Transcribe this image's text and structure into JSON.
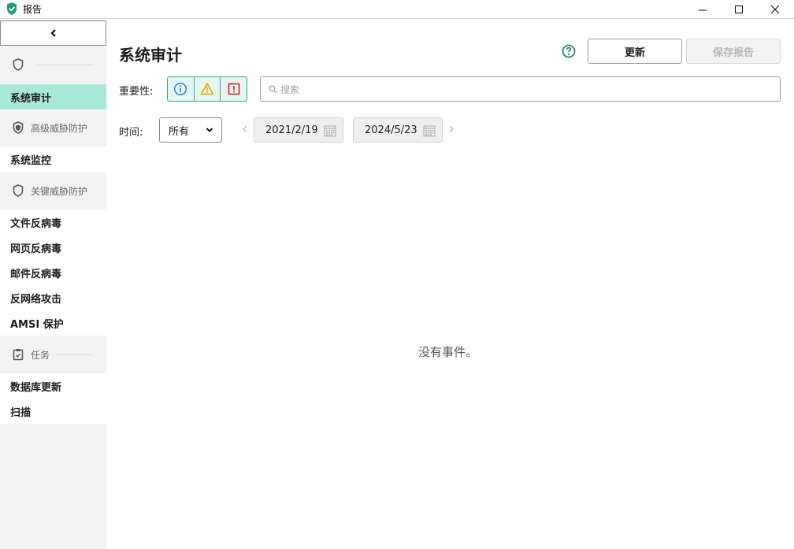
{
  "window": {
    "title": "报告"
  },
  "sidebar": {
    "sections": [
      {
        "label": "",
        "icon": "shield-icon"
      },
      {
        "label": "高级威胁防护",
        "icon": "shield-icon"
      },
      {
        "label": "关键威胁防护",
        "icon": "shield-icon"
      },
      {
        "label": "任务",
        "icon": "clipboard-check-icon"
      }
    ],
    "items": [
      {
        "label": "系统审计",
        "active": true
      },
      {
        "label": "系统监控"
      },
      {
        "label": "文件反病毒"
      },
      {
        "label": "网页反病毒"
      },
      {
        "label": "邮件反病毒"
      },
      {
        "label": "反网络攻击"
      },
      {
        "label": "AMSI 保护"
      },
      {
        "label": "数据库更新"
      },
      {
        "label": "扫描"
      }
    ]
  },
  "main": {
    "title": "系统审计",
    "refresh_label": "更新",
    "save_label": "保存报告",
    "severity_label": "重要性:",
    "search_placeholder": "搜索",
    "time_label": "时间:",
    "time_select": "所有",
    "date_from": "2021/2/19",
    "date_to": "2024/5/23",
    "empty_message": "没有事件。"
  },
  "colors": {
    "accent": "#2ea88a",
    "active_bg": "#a8e8d8",
    "info": "#1f8fd0",
    "warning": "#f0a500",
    "critical": "#d0202b"
  }
}
